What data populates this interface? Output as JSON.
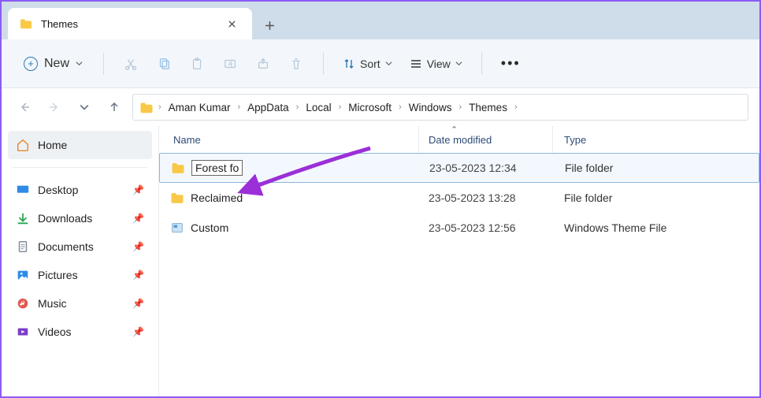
{
  "tab": {
    "title": "Themes"
  },
  "toolbar": {
    "new_label": "New",
    "sort_label": "Sort",
    "view_label": "View"
  },
  "breadcrumbs": [
    "Aman Kumar",
    "AppData",
    "Local",
    "Microsoft",
    "Windows",
    "Themes"
  ],
  "sidebar": {
    "home": "Home",
    "items": [
      {
        "label": "Desktop",
        "icon": "desktop"
      },
      {
        "label": "Downloads",
        "icon": "downloads"
      },
      {
        "label": "Documents",
        "icon": "documents"
      },
      {
        "label": "Pictures",
        "icon": "pictures"
      },
      {
        "label": "Music",
        "icon": "music"
      },
      {
        "label": "Videos",
        "icon": "videos"
      }
    ]
  },
  "columns": {
    "name": "Name",
    "date": "Date modified",
    "type": "Type"
  },
  "rows": [
    {
      "name": "Forest fo",
      "date": "23-05-2023 12:34",
      "type": "File folder",
      "icon": "folder",
      "editing": true
    },
    {
      "name": "Reclaimed",
      "date": "23-05-2023 13:28",
      "type": "File folder",
      "icon": "folder",
      "editing": false
    },
    {
      "name": "Custom",
      "date": "23-05-2023 12:56",
      "type": "Windows Theme File",
      "icon": "theme",
      "editing": false
    }
  ]
}
